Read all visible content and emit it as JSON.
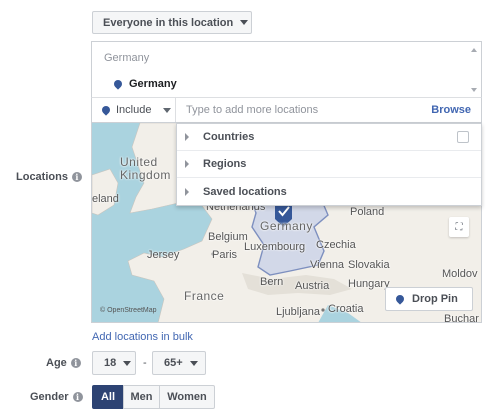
{
  "audience": {
    "dropdown_label": "Everyone in this location"
  },
  "locations": {
    "label": "Locations",
    "group_header": "Germany",
    "selected": [
      "Germany"
    ],
    "include_label": "Include",
    "input_placeholder": "Type to add more locations",
    "browse_label": "Browse",
    "browse_menu": [
      "Countries",
      "Regions",
      "Saved locations"
    ]
  },
  "map": {
    "labels": [
      "United Kingdom",
      "Ireland",
      "Netherlands",
      "Germany",
      "Poland",
      "Belgium",
      "Luxembourg",
      "Czechia",
      "Jersey",
      "Paris",
      "Vienna",
      "Slovakia",
      "Bern",
      "Austria",
      "Hungary",
      "Moldov",
      "France",
      "Ljubljana",
      "Croatia",
      "Buchar"
    ],
    "attribution": "© OpenStreetMap",
    "drop_pin_label": "Drop Pin"
  },
  "bulk_link": "Add locations in bulk",
  "age": {
    "label": "Age",
    "min": "18",
    "separator": "-",
    "max": "65+"
  },
  "gender": {
    "label": "Gender",
    "options": [
      "All",
      "Men",
      "Women"
    ],
    "selected": "All"
  },
  "colors": {
    "accent": "#4267b2",
    "selected_segment": "#2d4373",
    "pin": "#365899",
    "water": "#aad3df",
    "land": "#f2efe9"
  }
}
